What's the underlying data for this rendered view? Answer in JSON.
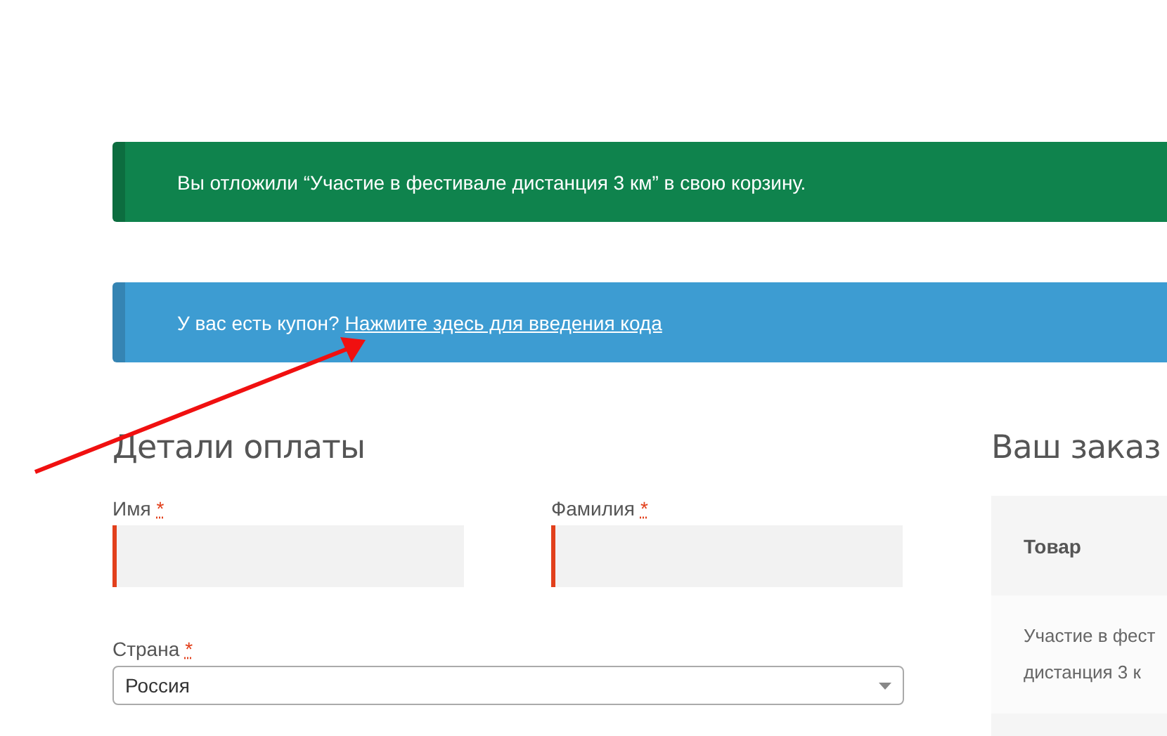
{
  "notices": [
    {
      "kind": "success",
      "text": "Вы отложили “Участие в фестивале дистанция 3 км” в свою корзину."
    },
    {
      "kind": "info",
      "text": "У вас есть купон?",
      "link": "Нажмите здесь для введения кода"
    }
  ],
  "billing": {
    "title": "Детали оплаты",
    "fields": [
      {
        "label": "Имя",
        "required_mark": "*",
        "invalid": true
      },
      {
        "label": "Фамилия",
        "required_mark": "*",
        "invalid": true
      }
    ],
    "country": {
      "label": "Страна",
      "required_mark": "*",
      "value": "Россия"
    }
  },
  "order": {
    "title": "Ваш заказ",
    "column_header": "Товар",
    "rows": [
      {
        "lines": [
          "Участие в фест",
          "дистанция 3 к"
        ]
      }
    ]
  }
}
